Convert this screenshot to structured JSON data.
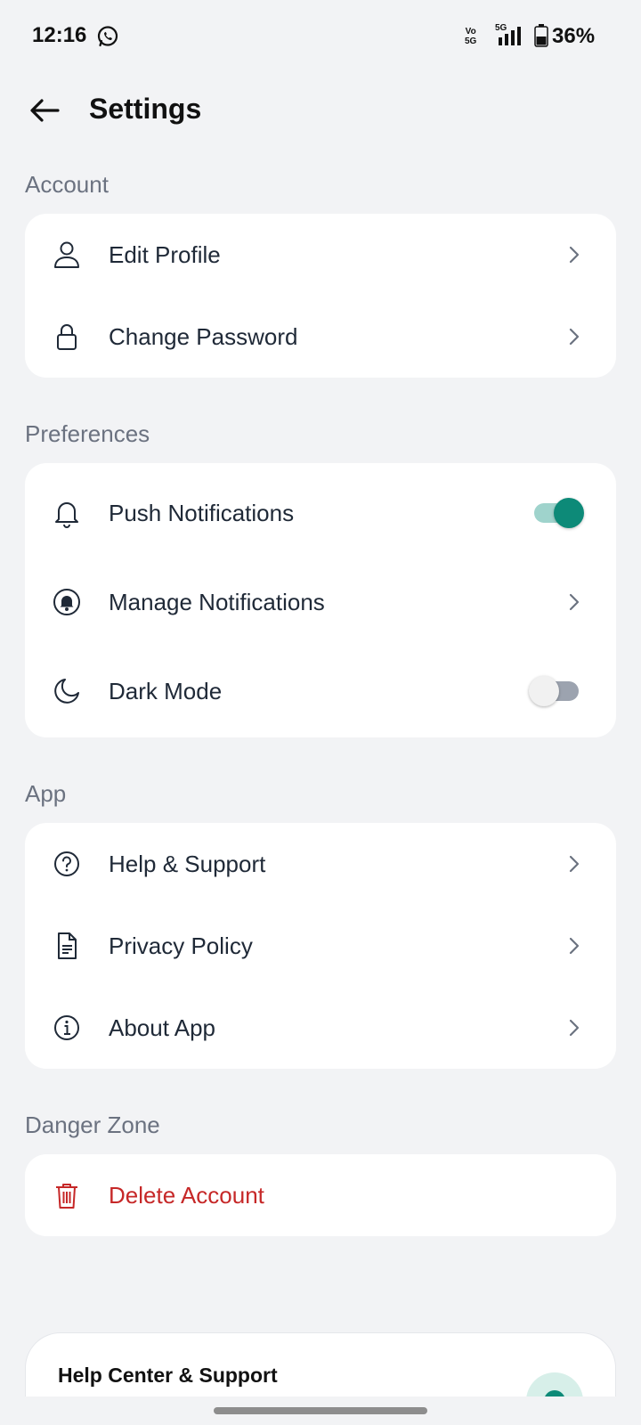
{
  "status_bar": {
    "time": "12:16",
    "network_top": "Vo",
    "network_bottom": "5G",
    "network_type": "5G",
    "battery_percent": "36%"
  },
  "header": {
    "title": "Settings",
    "back_icon": "arrow-left-icon"
  },
  "sections": {
    "account": {
      "title": "Account",
      "items": [
        {
          "label": "Edit Profile",
          "icon": "user-icon"
        },
        {
          "label": "Change Password",
          "icon": "lock-icon"
        }
      ]
    },
    "preferences": {
      "title": "Preferences",
      "items": [
        {
          "label": "Push Notifications",
          "icon": "bell-icon",
          "toggle": true
        },
        {
          "label": "Manage Notifications",
          "icon": "bell-circle-icon"
        },
        {
          "label": "Dark Mode",
          "icon": "moon-icon",
          "toggle": false
        }
      ]
    },
    "app": {
      "title": "App",
      "items": [
        {
          "label": "Help & Support",
          "icon": "help-circle-icon"
        },
        {
          "label": "Privacy Policy",
          "icon": "document-icon"
        },
        {
          "label": "About App",
          "icon": "info-icon"
        }
      ]
    },
    "danger": {
      "title": "Danger Zone",
      "items": [
        {
          "label": "Delete Account",
          "icon": "trash-icon"
        }
      ]
    }
  },
  "help_card": {
    "title": "Help Center & Support"
  },
  "colors": {
    "accent": "#0d8a78",
    "danger": "#c62828",
    "background": "#f2f3f5",
    "section_title": "#6b7280"
  }
}
